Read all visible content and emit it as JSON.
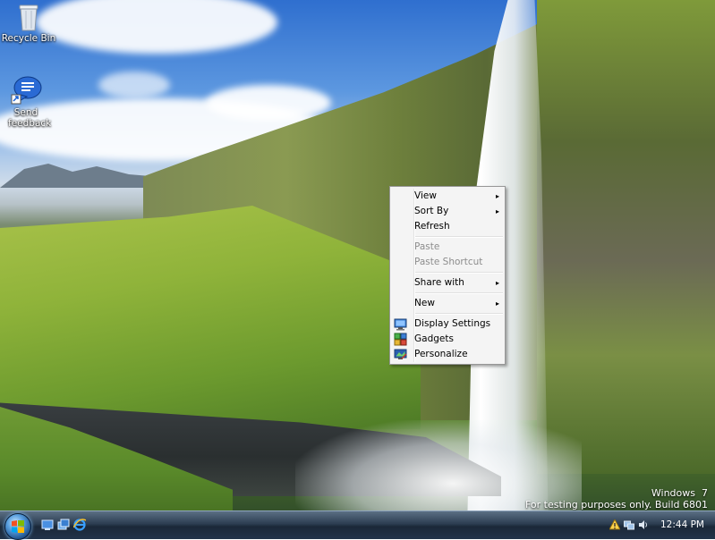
{
  "desktop": {
    "icons": [
      {
        "label": "Recycle Bin",
        "icon": "recycle-bin-icon"
      },
      {
        "label": "Send feedback",
        "icon": "feedback-icon"
      }
    ]
  },
  "watermark": {
    "line1": "Windows  7",
    "line2": "For testing purposes only. Build 6801"
  },
  "context_menu": {
    "items": [
      {
        "label": "View",
        "submenu": true,
        "enabled": true
      },
      {
        "label": "Sort By",
        "submenu": true,
        "enabled": true
      },
      {
        "label": "Refresh",
        "submenu": false,
        "enabled": true
      },
      {
        "label": "Paste",
        "submenu": false,
        "enabled": false
      },
      {
        "label": "Paste Shortcut",
        "submenu": false,
        "enabled": false
      },
      {
        "label": "Share with",
        "submenu": true,
        "enabled": true
      },
      {
        "label": "New",
        "submenu": true,
        "enabled": true
      },
      {
        "label": "Display Settings",
        "submenu": false,
        "enabled": true,
        "icon": "display-settings-icon"
      },
      {
        "label": "Gadgets",
        "submenu": false,
        "enabled": true,
        "icon": "gadgets-icon"
      },
      {
        "label": "Personalize",
        "submenu": false,
        "enabled": true,
        "icon": "personalize-icon"
      }
    ],
    "submenu_arrow": "▸"
  },
  "taskbar": {
    "start_icon": "windows-logo-icon",
    "quick_launch": [
      "show-desktop-icon",
      "switch-windows-icon",
      "internet-explorer-icon"
    ],
    "tray_icons": [
      "action-center-icon",
      "network-icon",
      "volume-icon"
    ],
    "clock": "12:44 PM"
  },
  "colors": {
    "menu_bg": "#f4f4f4",
    "menu_border": "#979797",
    "disabled_text": "#8d8d8d",
    "taskbar_bg": "#22334a"
  }
}
